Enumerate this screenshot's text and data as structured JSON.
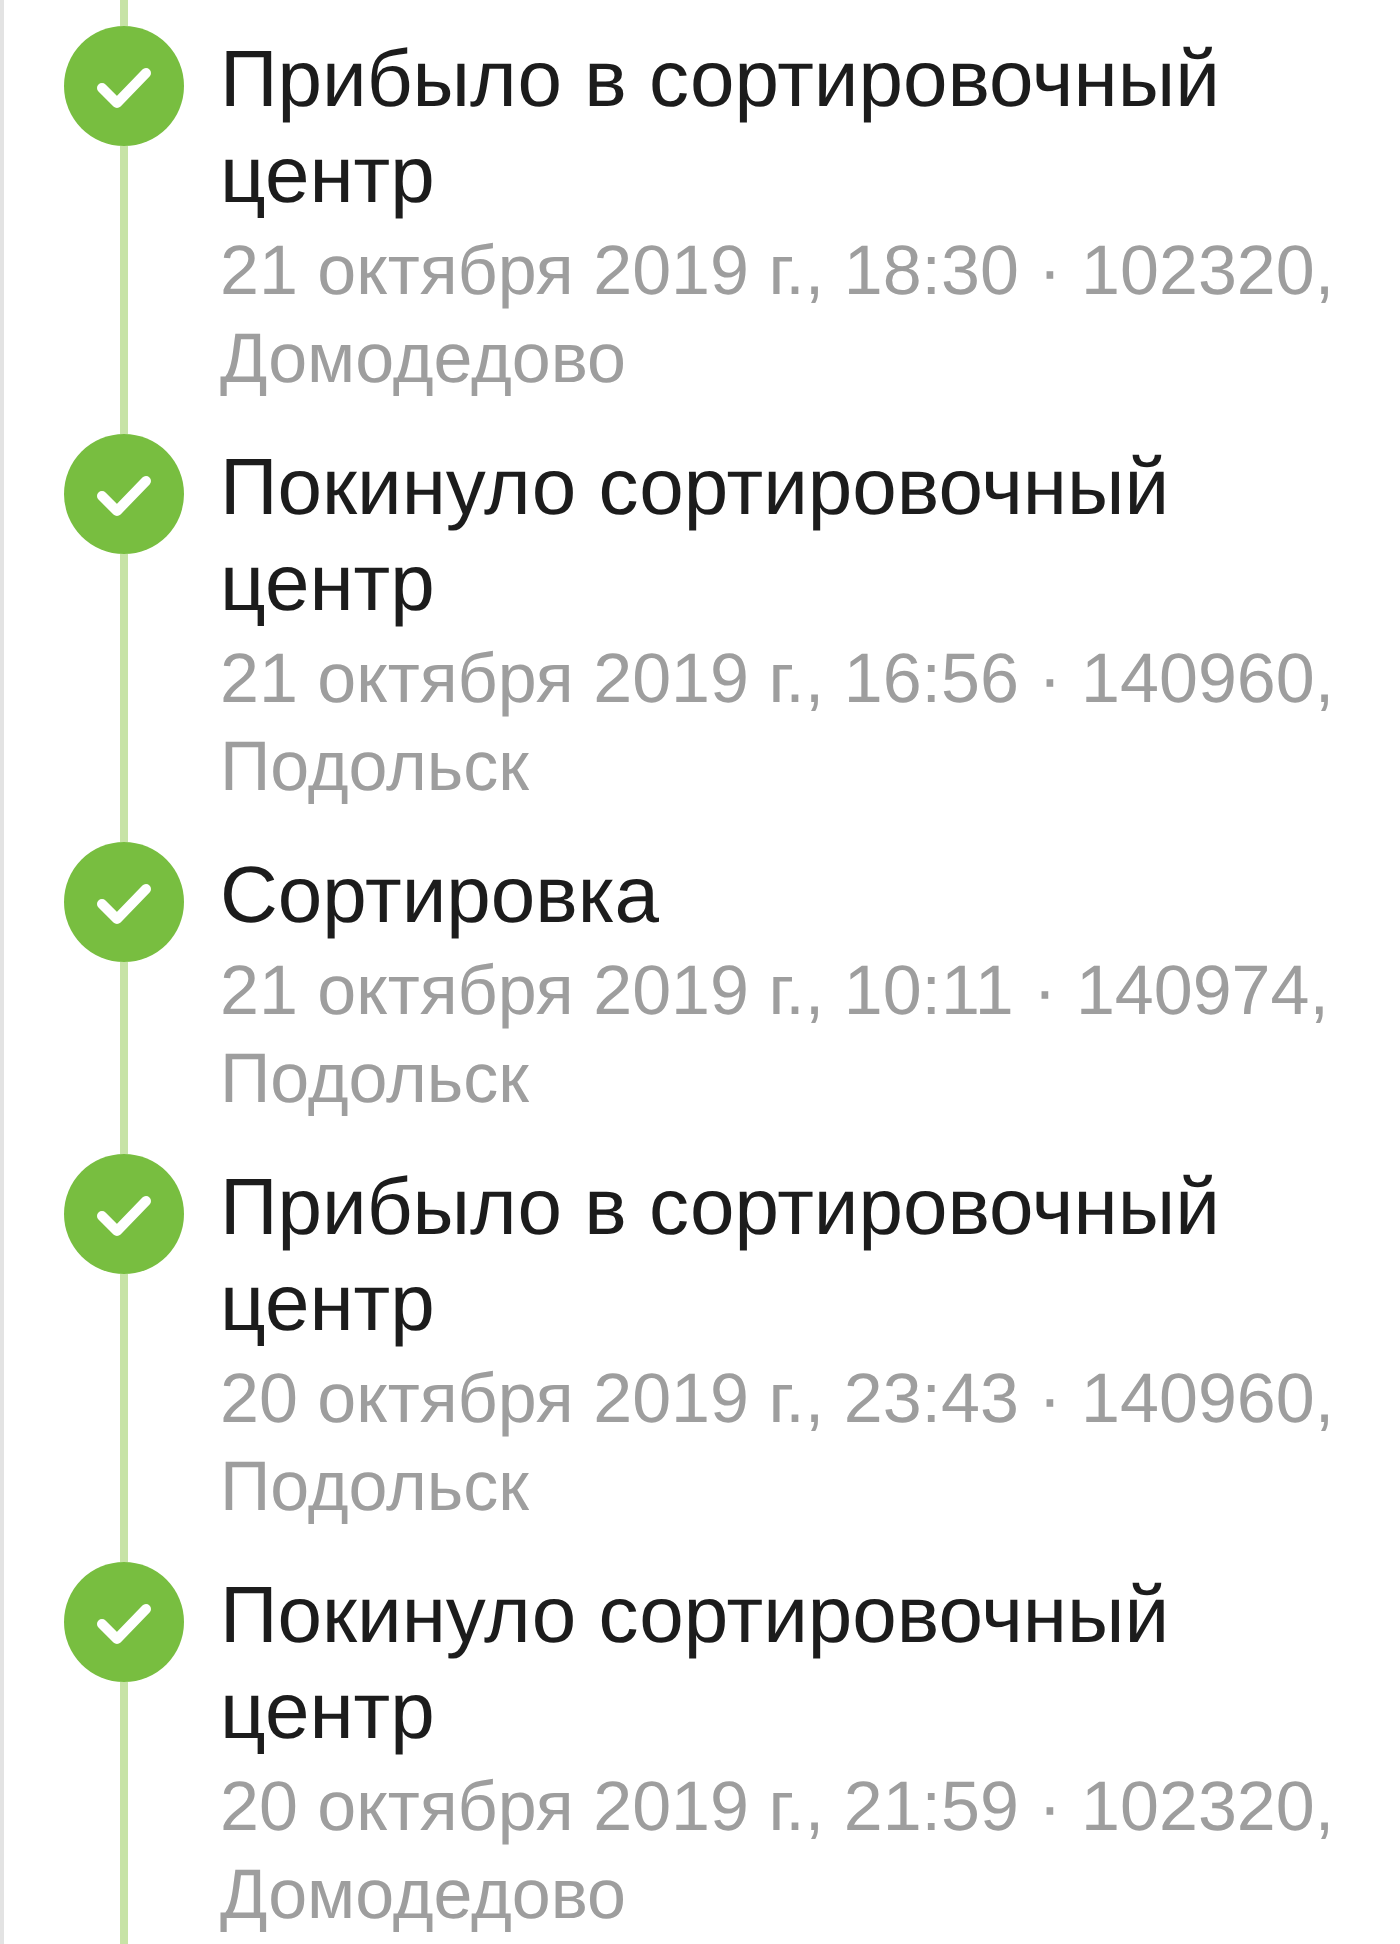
{
  "events": [
    {
      "title": "Прибыло в сортировочный центр",
      "details": "21 октября 2019 г., 18:30 · 102320, Домодедово",
      "completed": true
    },
    {
      "title": "Покинуло сортировочный центр",
      "details": "21 октября 2019 г., 16:56 · 140960, Подольск",
      "completed": true
    },
    {
      "title": "Сортировка",
      "details": "21 октября 2019 г., 10:11 · 140974, Подольск",
      "completed": true
    },
    {
      "title": "Прибыло в сортировочный центр",
      "details": "20 октября 2019 г., 23:43 · 140960, Подольск",
      "completed": true
    },
    {
      "title": "Покинуло сортировочный центр",
      "details": "20 октября 2019 г., 21:59 · 102320, Домодедово",
      "completed": true
    }
  ]
}
